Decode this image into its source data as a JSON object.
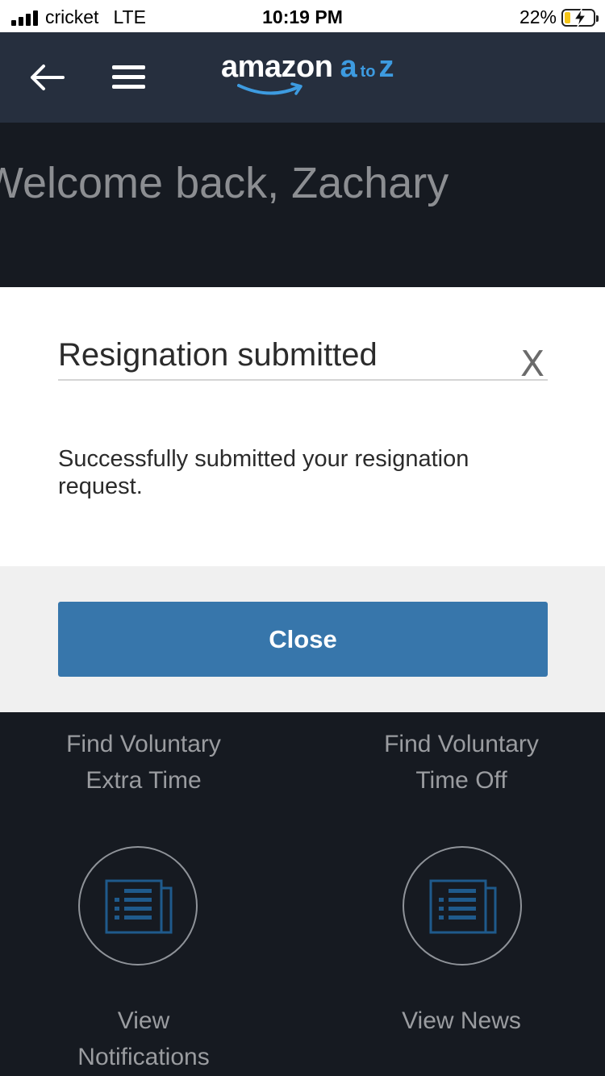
{
  "status_bar": {
    "carrier": "cricket",
    "network": "LTE",
    "time": "10:19 PM",
    "battery_percent": "22%",
    "battery_level": 0.22
  },
  "header": {
    "logo_amazon": "amazon",
    "logo_a": "a",
    "logo_to": "to",
    "logo_z": "z",
    "back_icon": "arrow-left-icon",
    "menu_icon": "hamburger-menu-icon"
  },
  "welcome_text": "Welcome back, Zachary",
  "modal": {
    "title": "Resignation submitted",
    "close_glyph": "X",
    "message": "Successfully submitted your resignation request.",
    "close_button_label": "Close"
  },
  "tiles": {
    "vet_line1": "Find Voluntary",
    "vet_line2": "Extra Time",
    "vto_line1": "Find Voluntary",
    "vto_line2": "Time Off",
    "notifications_line1": "View",
    "notifications_line2": "Notifications",
    "news_label": "View News",
    "tile_icon": "newspaper-icon"
  },
  "colors": {
    "header_bg": "#262f3e",
    "page_bg": "#161a21",
    "accent_blue": "#3776ab",
    "logo_blue": "#3d9be0",
    "icon_blue": "#1f5a8c"
  }
}
